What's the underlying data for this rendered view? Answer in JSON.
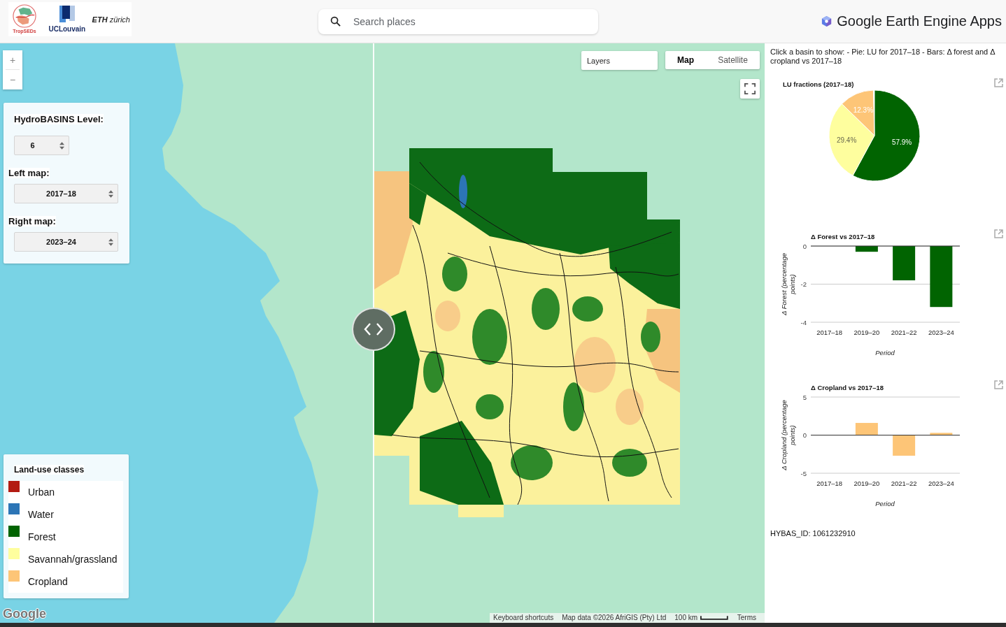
{
  "header": {
    "logos": [
      {
        "kind": "tropseds",
        "text": "TropSEDs"
      },
      {
        "kind": "uclouvain",
        "text": "UCLouvain"
      },
      {
        "kind": "eth",
        "text": "**ETH** zürich"
      }
    ],
    "search": {
      "placeholder": "Search places"
    },
    "app_title": "Google Earth Engine Apps"
  },
  "map": {
    "zoom_in": "+",
    "zoom_out": "−",
    "layers_button": "Layers",
    "map_types": [
      {
        "label": "Map",
        "selected": true
      },
      {
        "label": "Satellite",
        "selected": false
      }
    ],
    "basin_panel": {
      "fields": [
        {
          "kind": "number",
          "label": "HydroBASINS Level:",
          "value": "6"
        },
        {
          "kind": "select",
          "label": "Left map:",
          "value": "2017–18"
        },
        {
          "kind": "select",
          "label": "Right map:",
          "value": "2023–24"
        }
      ]
    },
    "legend": {
      "title": "Land-use classes",
      "items": [
        {
          "label": "Urban",
          "color": "#b31b12"
        },
        {
          "label": "Water",
          "color": "#2c75b6"
        },
        {
          "label": "Forest",
          "color": "#016401"
        },
        {
          "label": "Savannah/grassland",
          "color": "#fefe9e"
        },
        {
          "label": "Cropland",
          "color": "#fdc577"
        }
      ]
    },
    "logo": "Google",
    "attribution": {
      "shortcuts": "Keyboard shortcuts",
      "map_data": "Map data ©2026 AfriGIS (Pty) Ltd",
      "scale": "100 km",
      "terms": "Terms"
    }
  },
  "info_panel": {
    "intro": "Click a basin to show: - Pie: LU for 2017–18 - Bars: Δ forest and Δ cropland vs 2017–18",
    "charts": [
      {
        "chart_data": {
          "type": "pie",
          "title": "LU fractions (2017–18)",
          "values": [
            57.9,
            29.4,
            12.3
          ],
          "value_labels": [
            "57.9%",
            "29.4%",
            "12.3%"
          ],
          "colors": [
            "#016401",
            "#fefe9e",
            "#fdc577"
          ]
        }
      },
      {
        "chart_data": {
          "type": "bar",
          "title": "Δ Forest vs 2017–18",
          "xlabel": "Period",
          "ylabel": "Δ Forest (percentage points)",
          "categories": [
            "2017–18",
            "2019–20",
            "2021–22",
            "2023–24"
          ],
          "series": [
            {
              "color": "#016401",
              "values": [
                0,
                -0.3,
                -1.8,
                -3.2
              ]
            }
          ],
          "ylim": [
            -4,
            0
          ],
          "yticks": [
            0,
            -2,
            -4
          ]
        }
      },
      {
        "chart_data": {
          "type": "bar",
          "title": "Δ Cropland vs 2017–18",
          "xlabel": "Period",
          "ylabel": "Δ Cropland (percentage points)",
          "categories": [
            "2017–18",
            "2019–20",
            "2021–22",
            "2023–24"
          ],
          "series": [
            {
              "color": "#fdc577",
              "values": [
                0,
                1.6,
                -2.7,
                0.3
              ]
            }
          ],
          "ylim": [
            -5,
            5
          ],
          "yticks": [
            5,
            0,
            -5
          ]
        }
      }
    ],
    "basin_id": "HYBAS_ID: 1061232910"
  }
}
